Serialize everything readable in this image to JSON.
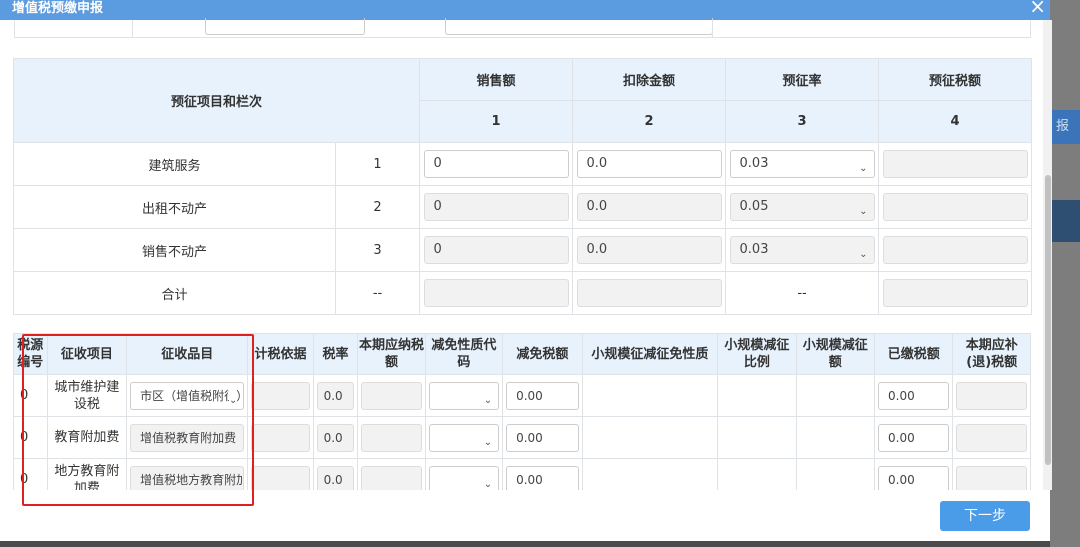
{
  "modal": {
    "title": "增值税预缴申报",
    "close": "×",
    "next_label": "下一步"
  },
  "background": {
    "btn_fragment": "报"
  },
  "prepay": {
    "header_item": "预征项目和栏次",
    "columns": [
      {
        "label": "销售额",
        "no": "1"
      },
      {
        "label": "扣除金额",
        "no": "2"
      },
      {
        "label": "预征率",
        "no": "3"
      },
      {
        "label": "预征税额",
        "no": "4"
      }
    ],
    "rows": [
      {
        "name": "建筑服务",
        "no": "1",
        "sales": "0",
        "deduct": "0.0",
        "rate": "0.03",
        "sales_editable": true,
        "deduct_editable": true
      },
      {
        "name": "出租不动产",
        "no": "2",
        "sales": "0",
        "deduct": "0.0",
        "rate": "0.05",
        "sales_editable": false,
        "deduct_editable": false
      },
      {
        "name": "销售不动产",
        "no": "3",
        "sales": "0",
        "deduct": "0.0",
        "rate": "0.03",
        "sales_editable": false,
        "deduct_editable": false
      }
    ],
    "total": {
      "name": "合计",
      "no": "--",
      "rate": "--"
    }
  },
  "surtax": {
    "headers": [
      "税源编号",
      "征收项目",
      "征收品目",
      "计税依据",
      "税率",
      "本期应纳税额",
      "减免性质代码",
      "减免税额",
      "小规模征减征免性质",
      "小规模减征比例",
      "小规模减征额",
      "已缴税额",
      "本期应补(退)税额"
    ],
    "rows": [
      {
        "src": "0",
        "item": "城市维护建设税",
        "sub": "市区（增值税附征）",
        "rate": "0.0",
        "relief": "0.00",
        "paid": "0.00"
      },
      {
        "src": "0",
        "item": "教育附加费",
        "sub": "增值税教育附加费",
        "rate": "0.0",
        "relief": "0.00",
        "paid": "0.00"
      },
      {
        "src": "0",
        "item": "地方教育附加费",
        "sub": "增值税地方教育附加",
        "rate": "0.0",
        "relief": "0.00",
        "paid": "0.00"
      }
    ]
  }
}
